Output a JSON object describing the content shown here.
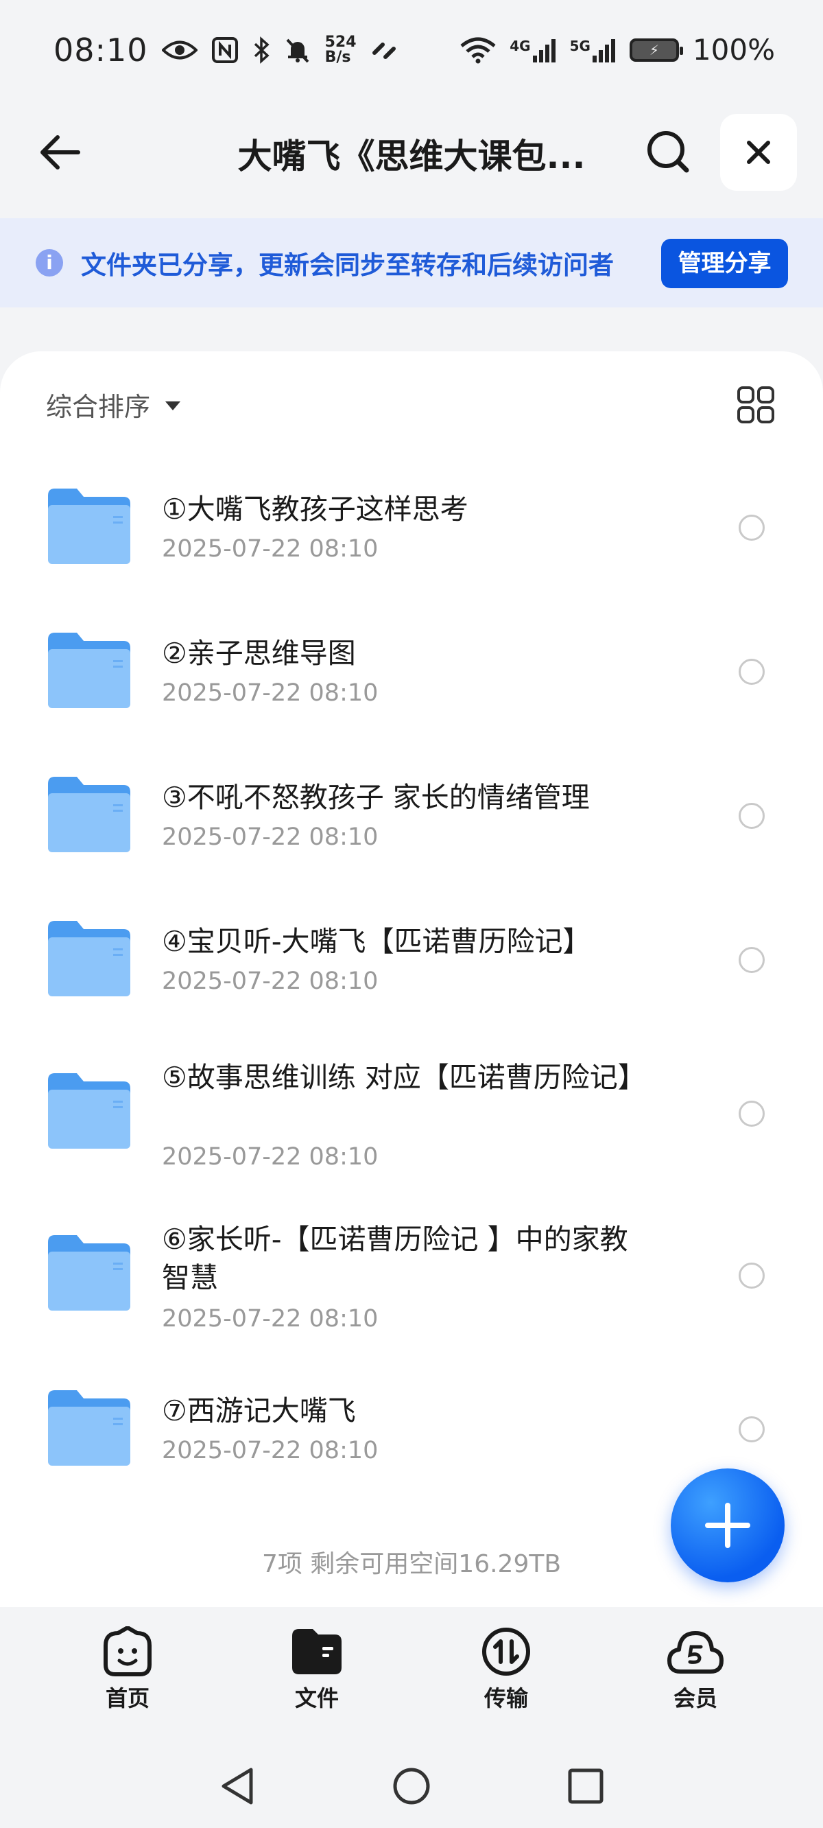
{
  "status_bar": {
    "time": "08:10",
    "net_speed_value": "524",
    "net_speed_unit": "B/s",
    "signal_4g": "4G",
    "signal_5g": "5G",
    "battery": "100%"
  },
  "header": {
    "title": "大嘴飞《思维大课包..."
  },
  "banner": {
    "text": "文件夹已分享，更新会同步至转存和后续访问者",
    "button": "管理分享"
  },
  "toolbar": {
    "sort_label": "综合排序"
  },
  "files": [
    {
      "name": "①大嘴飞教孩子这样思考",
      "date": "2025-07-22 08:10"
    },
    {
      "name": "②亲子思维导图",
      "date": "2025-07-22 08:10"
    },
    {
      "name": "③不吼不怒教孩子 家长的情绪管理",
      "date": "2025-07-22 08:10"
    },
    {
      "name": "④宝贝听-大嘴飞【匹诺曹历险记】",
      "date": "2025-07-22 08:10"
    },
    {
      "name": "⑤故事思维训练 对应【匹诺曹历险记】",
      "date": "2025-07-22 08:10"
    },
    {
      "name": "⑥家长听-【匹诺曹历险记 】中的家教智慧",
      "date": "2025-07-22 08:10"
    },
    {
      "name": "⑦西游记大嘴飞",
      "date": "2025-07-22 08:10"
    }
  ],
  "footer": {
    "summary": "7项 剩余可用空间16.29TB"
  },
  "nav": {
    "home": "首页",
    "files": "文件",
    "transfer": "传输",
    "vip": "会员"
  },
  "colors": {
    "accent": "#0a55e0",
    "banner_bg": "#e8edfb",
    "banner_text": "#1f5bd8",
    "folder": "#5aa8f5"
  }
}
